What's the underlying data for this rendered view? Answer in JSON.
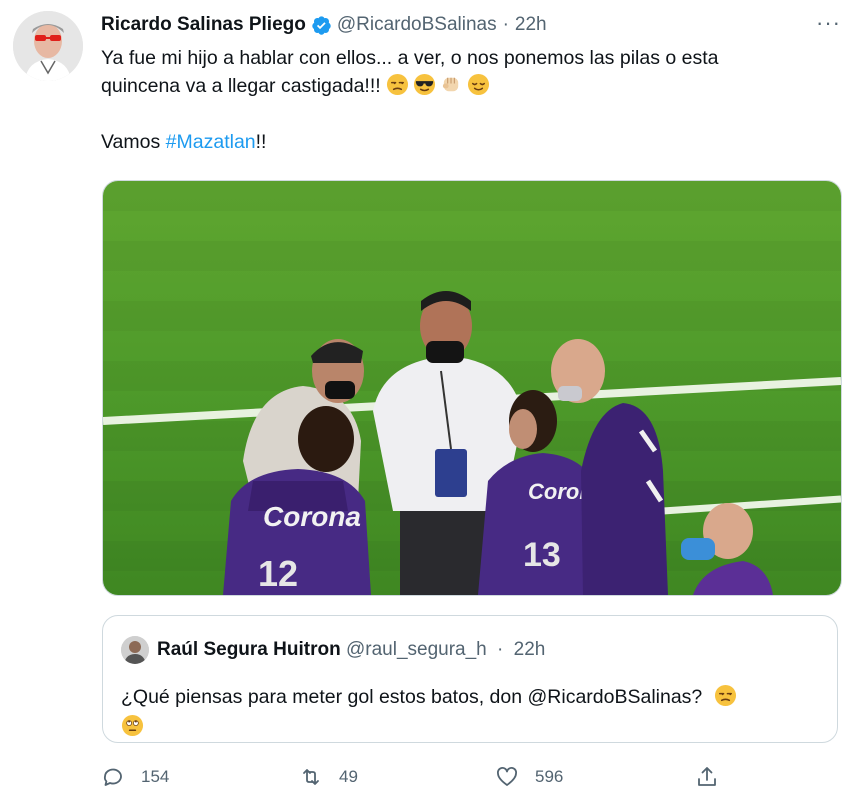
{
  "tweet": {
    "author_name": "Ricardo Salinas Pliego",
    "author_handle": "@RicardoBSalinas",
    "separator": "·",
    "time": "22h",
    "more_label": "···",
    "text_line1": "Ya fue mi hijo a hablar con ellos... a ver, o nos ponemos las pilas o esta",
    "text_line2": "quincena va a llegar castigada!!!",
    "text_line3_prefix": "Vamos ",
    "hashtag": "#Mazatlan",
    "text_line3_suffix": "!!",
    "emojis": [
      "unamused-face",
      "sunglasses-face",
      "fist-bump",
      "relieved-face"
    ]
  },
  "quote": {
    "author_name": "Raúl Segura Huitron",
    "author_handle": "@raul_segura_h",
    "separator": "·",
    "time": "22h",
    "text": "¿Qué piensas para meter gol estos batos, don @RicardoBSalinas?",
    "emojis": [
      "unamused-face",
      "eye-roll-face"
    ]
  },
  "actions": {
    "replies": "154",
    "retweets": "49",
    "likes": "596"
  },
  "colors": {
    "link": "#1d9bf0",
    "secondary": "#536471",
    "border": "#cfd9de",
    "verified": "#1d9bf0"
  }
}
